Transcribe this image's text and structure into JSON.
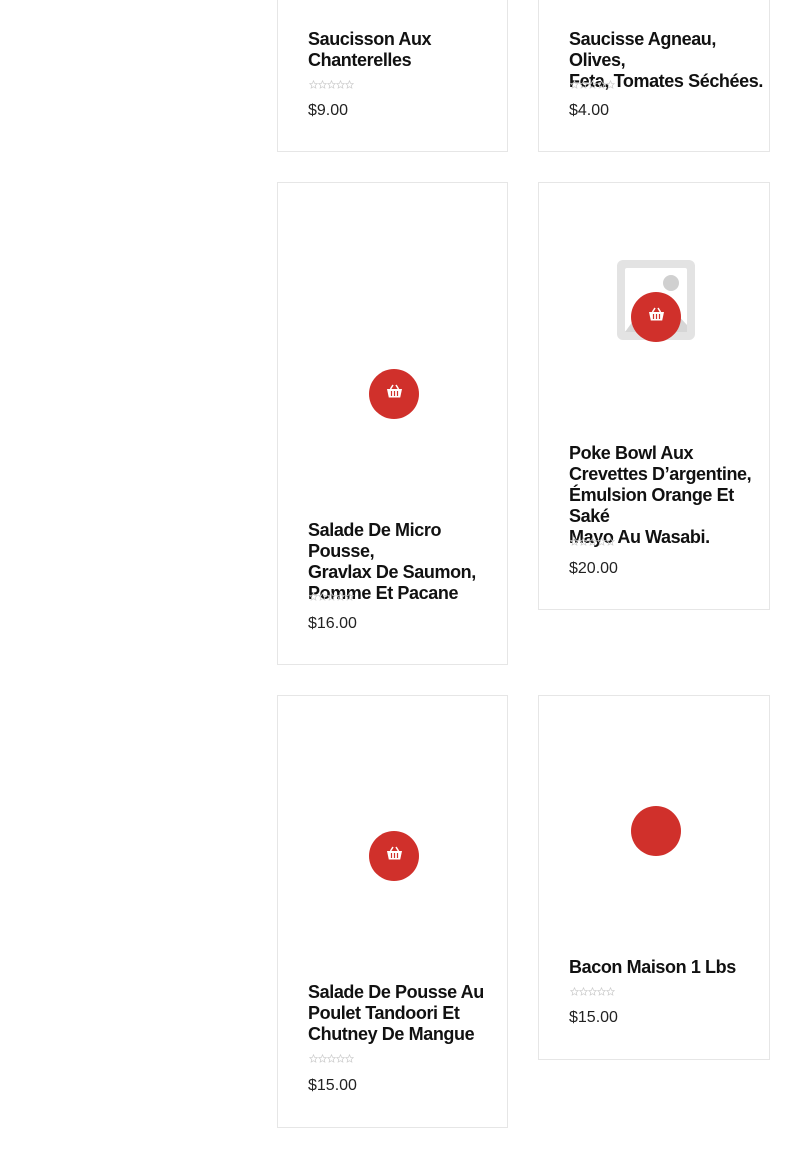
{
  "products": [
    {
      "title": "Saucisson Aux Chanterelles",
      "title_lines": [
        "Saucisson Aux",
        "Chanterelles"
      ],
      "price": "$9.00",
      "rating": "0"
    },
    {
      "title": "Saucisse Agneau, Olives, Feta, Tomates Séchées.",
      "title_lines": [
        "Saucisse Agneau, Olives,",
        "Feta, Tomates Séchées."
      ],
      "price": "$4.00",
      "rating": "0"
    },
    {
      "title": "Salade De Micro Pousse, Gravlax De Saumon, Pomme Et Pacane",
      "title_lines": [
        "Salade De Micro Pousse,",
        "Gravlax De Saumon,",
        "Pomme Et Pacane"
      ],
      "price": "$16.00",
      "rating": "0",
      "image": "blank"
    },
    {
      "title": "Poke Bowl Aux Crevettes D’argentine, Émulsion Orange Et Saké Mayo Au Wasabi.",
      "title_lines": [
        "Poke Bowl Aux",
        "Crevettes D’argentine,",
        "Émulsion Orange Et Saké",
        "Mayo Au Wasabi."
      ],
      "price": "$20.00",
      "rating": "0",
      "image": "placeholder-image"
    },
    {
      "title": "Salade De Pousse Au Poulet Tandoori Et Chutney De Mangue",
      "title_lines": [
        "Salade De Pousse Au",
        "Poulet Tandoori Et",
        "Chutney De Mangue"
      ],
      "price": "$15.00",
      "rating": "0",
      "image": "blank"
    },
    {
      "title": "Bacon Maison 1 Lbs",
      "title_lines": [
        "Bacon Maison 1 Lbs"
      ],
      "price": "$15.00",
      "rating": "0",
      "image": "blank"
    }
  ],
  "icons": {
    "cart": "basket-icon",
    "star": "star-icon"
  },
  "colors": {
    "accent": "#d0302b",
    "border": "#e6e6e6",
    "star_empty": "#cfcfcf"
  }
}
